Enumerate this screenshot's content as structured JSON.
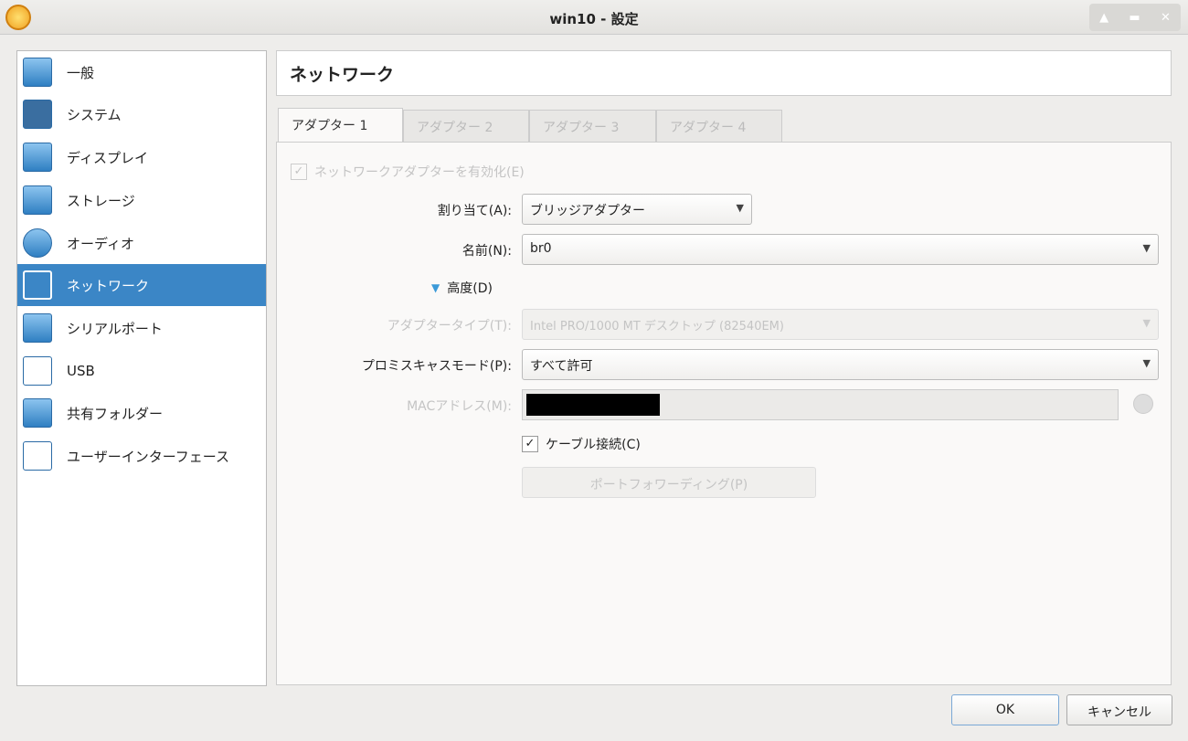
{
  "window": {
    "title": "win10 - 設定"
  },
  "sidebar": {
    "items": [
      {
        "label": "一般"
      },
      {
        "label": "システム"
      },
      {
        "label": "ディスプレイ"
      },
      {
        "label": "ストレージ"
      },
      {
        "label": "オーディオ"
      },
      {
        "label": "ネットワーク",
        "selected": true
      },
      {
        "label": "シリアルポート"
      },
      {
        "label": "USB"
      },
      {
        "label": "共有フォルダー"
      },
      {
        "label": "ユーザーインターフェース"
      }
    ]
  },
  "main": {
    "title": "ネットワーク",
    "tabs": [
      {
        "label": "アダプター 1",
        "active": true
      },
      {
        "label": "アダプター 2"
      },
      {
        "label": "アダプター 3"
      },
      {
        "label": "アダプター 4"
      }
    ],
    "enable_label": "ネットワークアダプターを有効化(E)",
    "attach_label": "割り当て(A):",
    "attach_value": "ブリッジアダプター",
    "name_label": "名前(N):",
    "name_value": "br0",
    "advanced_label": "高度(D)",
    "adapter_type_label": "アダプタータイプ(T):",
    "adapter_type_value": "Intel PRO/1000 MT デスクトップ (82540EM)",
    "promisc_label": "プロミスキャスモード(P):",
    "promisc_value": "すべて許可",
    "mac_label": "MACアドレス(M):",
    "cable_label": "ケーブル接続(C)",
    "port_forward_label": "ポートフォワーディング(P)"
  },
  "footer": {
    "ok": "OK",
    "cancel": "キャンセル"
  }
}
